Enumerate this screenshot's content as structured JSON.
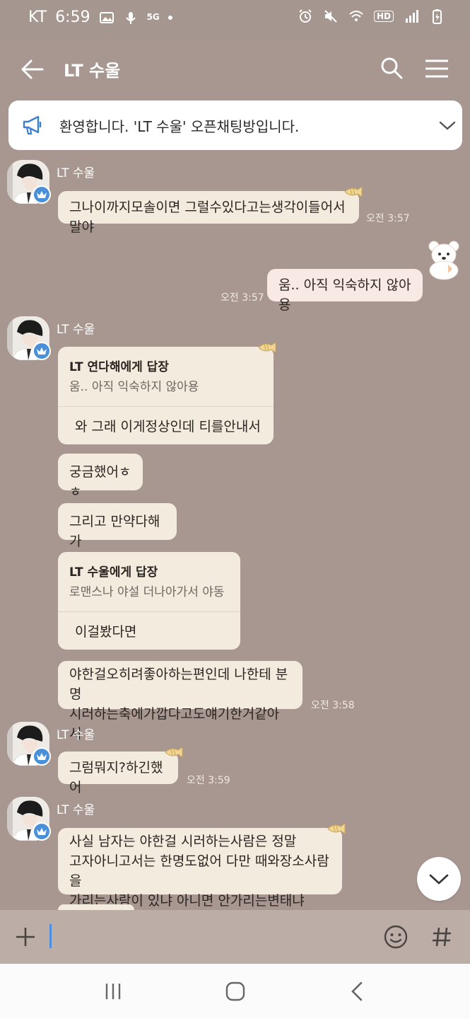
{
  "status_bar": {
    "carrier": "KT",
    "time": "6:59",
    "network_label": "5G",
    "hd_label": "HD"
  },
  "header": {
    "title": "LT 수울"
  },
  "notice": {
    "text": "환영합니다. 'LT 수울' 오픈채팅방입니다."
  },
  "messages": [
    {
      "sender": "LT 수울",
      "text": "그나이까지모솔이면 그럴수있다고는생각이들어서말야",
      "time": "오전 3:57"
    },
    {
      "text": "움.. 아직 익숙하지 않아용",
      "time": "오전 3:57"
    },
    {
      "sender": "LT 수울",
      "reply_title": "LT 연다해에게 답장",
      "reply_quote": "움.. 아직 익숙하지 않아용",
      "text": "와 그래 이게정상인데 티를안내서"
    },
    {
      "text": "궁금했어ㅎㅎ"
    },
    {
      "text": "그리고 만약다해가"
    },
    {
      "reply_title": "LT 수울에게 답장",
      "reply_quote": "로맨스나 야설 더나아가서 야동",
      "text": "이걸봤다면"
    },
    {
      "line1": "야한걸오히려좋아하는편인데 나한테 분명",
      "line2": "시러하는축에가깝다고도얘기한거같아서",
      "time": "오전 3:58"
    },
    {
      "sender": "LT 수울",
      "text": "그럼뭐지?하긴했어",
      "time": "오전 3:59"
    },
    {
      "sender": "LT 수울",
      "line1": "사실 남자는 야한걸 시러하는사람은 정말",
      "line2": "고자아니고서는 한명도없어 다만 때와장소사람을",
      "line3": "가리는사람이 있냐 아니면 안가리는변태냐"
    }
  ],
  "input": {
    "placeholder": ""
  },
  "colors": {
    "background": "#a89790",
    "bubble": "#f3ebde",
    "my_bubble": "#f8e9e4",
    "caret": "#4b8fe0"
  },
  "icons": [
    "back-arrow-icon",
    "search-icon",
    "menu-icon",
    "megaphone-icon",
    "chevron-down-icon",
    "crown-icon",
    "fish-icon",
    "bear-sticker-icon",
    "plus-icon",
    "emoji-icon",
    "hash-icon"
  ]
}
